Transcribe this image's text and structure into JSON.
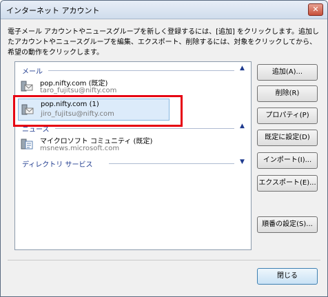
{
  "window": {
    "title": "インターネット アカウント",
    "close_symbol": "✕"
  },
  "description": "電子メール アカウントやニュースグループを新しく登録するには、[追加] をクリックします。追加したアカウントやニュースグループを編集、エクスポート、削除するには、対象をクリックしてから、希望の動作をクリックします。",
  "groups": {
    "mail": "メール",
    "news": "ニュース",
    "directory": "ディレクトリ サービス"
  },
  "accounts": [
    {
      "name": "pop.nifty.com (既定)",
      "email": "taro_fujitsu@nifty.com"
    },
    {
      "name": "pop.nifty.com (1)",
      "email": "jiro_fujitsu@nifty.com"
    },
    {
      "name": "マイクロソフト コミュニティ (既定)",
      "email": "msnews.microsoft.com"
    }
  ],
  "buttons": {
    "add": "追加(A)...",
    "delete": "削除(R)",
    "properties": "プロパティ(P)",
    "set_default": "既定に設定(D)",
    "import": "インポート(I)...",
    "export": "エクスポート(E)...",
    "order": "順番の設定(S)...",
    "close": "閉じる"
  },
  "colors": {
    "highlight": "#e60012",
    "group_text": "#1f3b8f",
    "selection": "#dcebfa"
  }
}
